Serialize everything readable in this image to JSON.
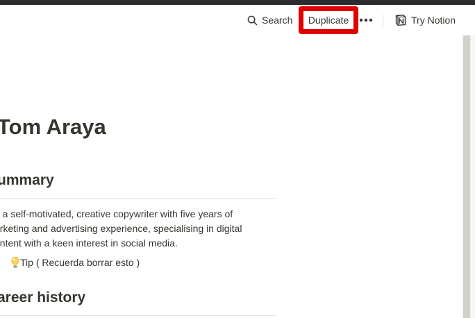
{
  "topbar": {
    "search_label": "Search",
    "duplicate_label": "Duplicate",
    "try_label": "Try Notion"
  },
  "page": {
    "title": "Tom Araya",
    "sections": [
      {
        "heading": "ummary",
        "lines": [
          "n a self-motivated, creative copywriter with five years of",
          "arketing and advertising experience, specialising in digital",
          "ontent with a keen interest in social media."
        ],
        "tip": "Tip ( Recuerda borrar esto )"
      },
      {
        "heading": "areer history"
      }
    ]
  },
  "colors": {
    "highlight": "#e00000",
    "text": "#37352f",
    "divider": "#e4e3e0"
  },
  "icons": {
    "search": "search-icon",
    "more": "more-horizontal-icon",
    "notion": "notion-logo-icon",
    "tip": "lightbulb-icon"
  }
}
